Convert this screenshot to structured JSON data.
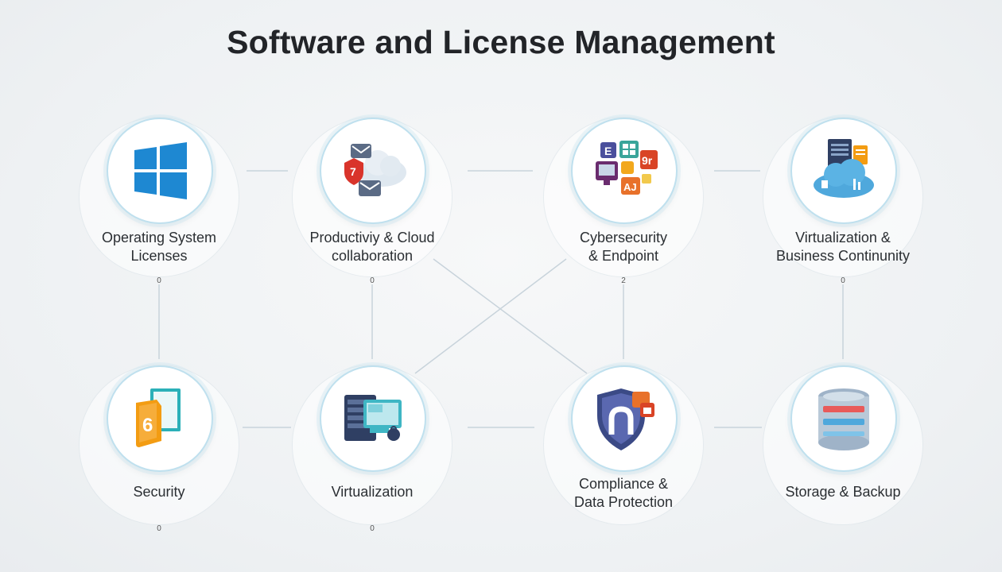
{
  "title": "Software and License Management",
  "nodes": [
    {
      "label_lines": [
        "Operating System",
        "Licenses"
      ],
      "marker": "0",
      "icon": "windows-logo-icon"
    },
    {
      "label_lines": [
        "Productiviy & Cloud",
        "collaboration"
      ],
      "marker": "0",
      "icon": "cloud-mail-shield-icon"
    },
    {
      "label_lines": [
        "Cybersecurity",
        "& Endpoint"
      ],
      "marker": "2",
      "icon": "app-tiles-icon"
    },
    {
      "label_lines": [
        "Virtualization &",
        "Business Continunity"
      ],
      "marker": "0",
      "icon": "cloud-server-icon"
    },
    {
      "label_lines": [
        "Security"
      ],
      "marker": "0",
      "icon": "document-lock-icon"
    },
    {
      "label_lines": [
        "Virtualization"
      ],
      "marker": "0",
      "icon": "server-monitor-icon"
    },
    {
      "label_lines": [
        "Compliance &",
        "Data Protection"
      ],
      "marker": "",
      "icon": "shield-lock-icon"
    },
    {
      "label_lines": [
        "Storage & Backup"
      ],
      "marker": "",
      "icon": "database-icon"
    }
  ],
  "colors": {
    "title": "#222428",
    "ring": "#bfe0ee",
    "line": "#c6d2da",
    "windows_blue": "#1e88d2",
    "orange": "#f39c12",
    "teal": "#3fb6c4",
    "navy": "#2f3f63"
  }
}
